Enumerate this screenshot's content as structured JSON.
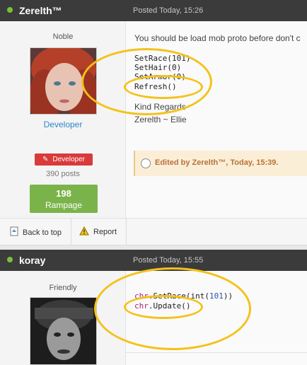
{
  "posts": [
    {
      "author": "Zerelth™",
      "date": "Posted Today, 15:26",
      "rank": "Noble",
      "group": "Developer",
      "badge": "Developer",
      "post_count": "390 posts",
      "reputation_value": "198",
      "reputation_label": "Rampage",
      "text_intro": "You should be load mob proto before don't c",
      "code_lines": [
        "SetRace(101)",
        "SetHair(0)",
        "SetArmor(0)",
        "Refresh()"
      ],
      "regards": "Kind Regards",
      "signature": "Zerelth ~ Ellie",
      "edited": "Edited by Zerelth™, Today, 15:39."
    },
    {
      "author": "koray",
      "date": "Posted Today, 15:55",
      "rank": "Friendly",
      "code_line_1": {
        "obj": "chr",
        "call": ".SetRace(int(",
        "num": "101",
        "end": "))"
      },
      "code_line_2": {
        "obj": "chr",
        "call": ".Update()"
      }
    }
  ],
  "actions": {
    "back_to_top": "Back to top",
    "report": "Report"
  },
  "icons": {
    "online": "online-dot-icon",
    "developer": "pencil-icon",
    "back": "page-up-icon",
    "report": "warning-triangle-icon",
    "edited": "magnifier-icon"
  },
  "colors": {
    "header_bg": "#3b3b3b",
    "online": "#7bbf3f",
    "developer_badge": "#d93a3a",
    "reputation": "#7ab34a",
    "highlight_ellipse": "#f4c21a",
    "link": "#2b88c8"
  }
}
